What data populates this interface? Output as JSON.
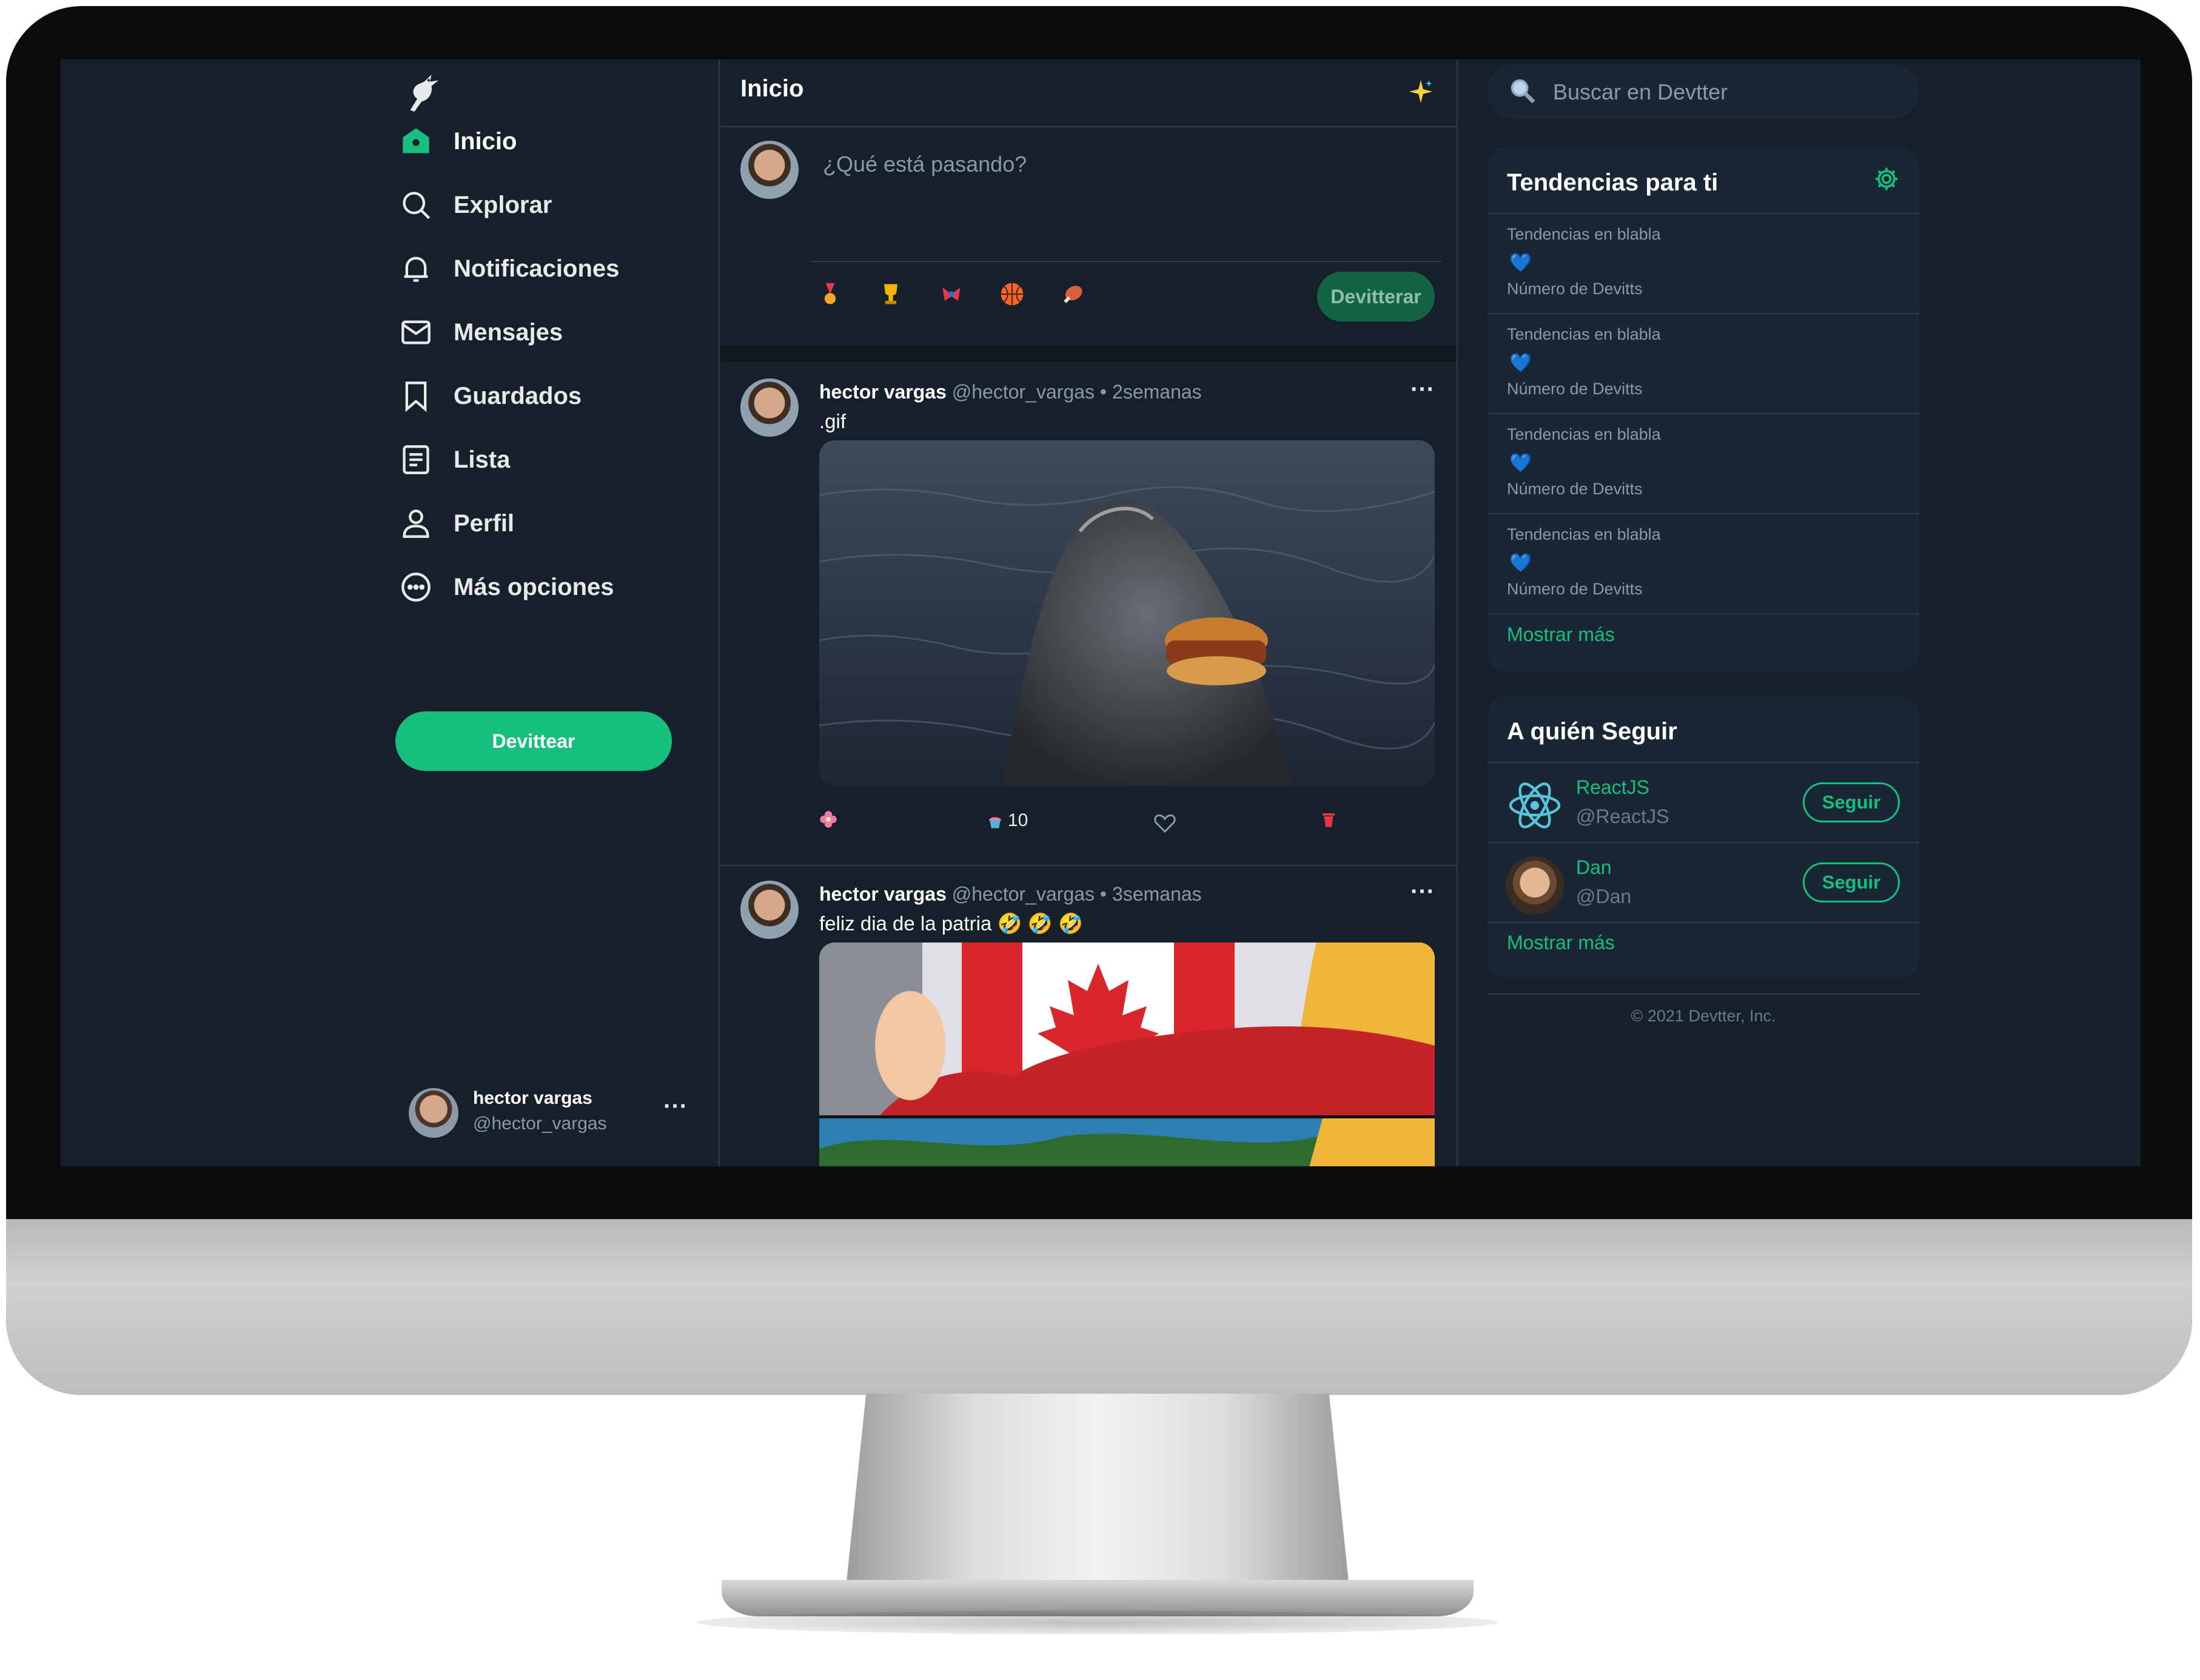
{
  "nav": {
    "items": [
      {
        "label": "Inicio",
        "icon": "home-icon"
      },
      {
        "label": "Explorar",
        "icon": "search-icon"
      },
      {
        "label": "Notificaciones",
        "icon": "bell-icon"
      },
      {
        "label": "Mensajes",
        "icon": "mail-icon"
      },
      {
        "label": "Guardados",
        "icon": "bookmark-icon"
      },
      {
        "label": "Lista",
        "icon": "list-icon"
      },
      {
        "label": "Perfil",
        "icon": "user-icon"
      },
      {
        "label": "Más opciones",
        "icon": "more-circle-icon"
      }
    ],
    "button_label": "Devittear"
  },
  "account": {
    "name": "hector vargas",
    "handle": "@hector_vargas",
    "more": "···"
  },
  "feed": {
    "title": "Inicio",
    "compose_placeholder": "¿Qué está pasando?",
    "compose_button": "Devitterar"
  },
  "tweets": [
    {
      "name": "hector vargas",
      "handle": "@hector_vargas",
      "dot": "•",
      "time": "2semanas",
      "text": ".gif",
      "retweet_count": "10",
      "more": "···"
    },
    {
      "name": "hector vargas",
      "handle": "@hector_vargas",
      "dot": "•",
      "time": "3semanas",
      "text": "feliz dia de la patria 🤣 🤣 🤣",
      "more": "···"
    }
  ],
  "search": {
    "placeholder": "Buscar en Devtter"
  },
  "trends": {
    "title": "Tendencias para ti",
    "items": [
      {
        "above": "Tendencias en blabla",
        "hashtag": "💙",
        "below": "Número de Devitts"
      },
      {
        "above": "Tendencias en blabla",
        "hashtag": "💙",
        "below": "Número de Devitts"
      },
      {
        "above": "Tendencias en blabla",
        "hashtag": "💙",
        "below": "Número de Devitts"
      },
      {
        "above": "Tendencias en blabla",
        "hashtag": "💙",
        "below": "Número de Devitts"
      }
    ],
    "show_more": "Mostrar más"
  },
  "who_to_follow": {
    "title": "A quién Seguir",
    "users": [
      {
        "name": "ReactJS",
        "handle": "@ReactJS",
        "button": "Seguir"
      },
      {
        "name": "Dan",
        "handle": "@Dan",
        "button": "Seguir"
      }
    ],
    "show_more": "Mostrar más"
  },
  "footer": {
    "copyright": "© 2021 Devtter, Inc."
  },
  "colors": {
    "accent": "#17bf7f",
    "background": "#15202b",
    "panel": "#192734",
    "trend_heart": "#2196f3"
  }
}
